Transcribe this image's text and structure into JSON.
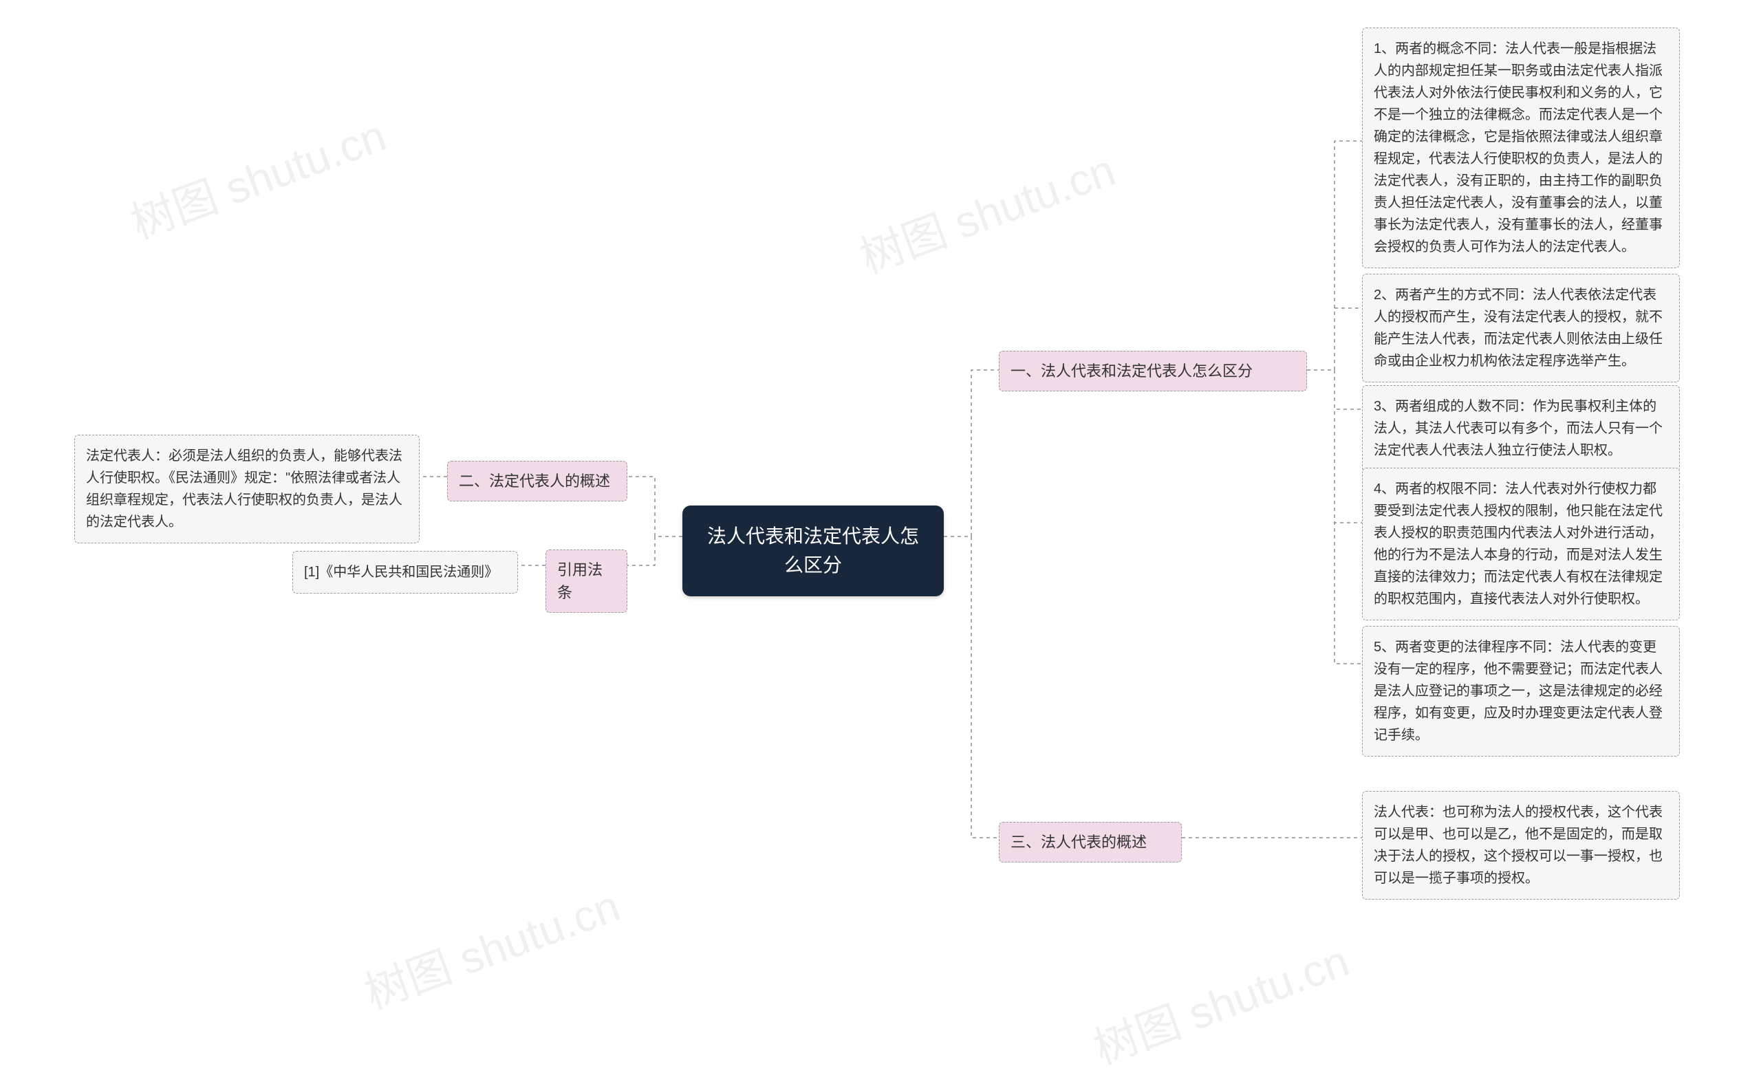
{
  "root": {
    "title": "法人代表和法定代表人怎么区分"
  },
  "sections": {
    "s1": {
      "title": "一、法人代表和法定代表人怎么区分",
      "items": [
        "1、两者的概念不同：法人代表一般是指根据法人的内部规定担任某一职务或由法定代表人指派代表法人对外依法行使民事权利和义务的人，它不是一个独立的法律概念。而法定代表人是一个确定的法律概念，它是指依照法律或法人组织章程规定，代表法人行使职权的负责人，是法人的法定代表人，没有正职的，由主持工作的副职负责人担任法定代表人，没有董事会的法人，以董事长为法定代表人，没有董事长的法人，经董事会授权的负责人可作为法人的法定代表人。",
        "2、两者产生的方式不同：法人代表依法定代表人的授权而产生，没有法定代表人的授权，就不能产生法人代表，而法定代表人则依法由上级任命或由企业权力机构依法定程序选举产生。",
        "3、两者组成的人数不同：作为民事权利主体的法人，其法人代表可以有多个，而法人只有一个法定代表人代表法人独立行使法人职权。",
        "4、两者的权限不同：法人代表对外行使权力都要受到法定代表人授权的限制，他只能在法定代表人授权的职责范围内代表法人对外进行活动，他的行为不是法人本身的行动，而是对法人发生直接的法律效力；而法定代表人有权在法律规定的职权范围内，直接代表法人对外行使职权。",
        "5、两者变更的法律程序不同：法人代表的变更没有一定的程序，他不需要登记；而法定代表人是法人应登记的事项之一，这是法律规定的必经程序，如有变更，应及时办理变更法定代表人登记手续。"
      ]
    },
    "s2": {
      "title": "二、法定代表人的概述",
      "leaf": "法定代表人：必须是法人组织的负责人，能够代表法人行使职权。《民法通则》规定：\"依照法律或者法人组织章程规定，代表法人行使职权的负责人，是法人的法定代表人。"
    },
    "s3": {
      "title": "三、法人代表的概述",
      "leaf": "法人代表：也可称为法人的授权代表，这个代表可以是甲、也可以是乙，他不是固定的，而是取决于法人的授权，这个授权可以一事一授权，也可以是一揽子事项的授权。"
    },
    "s4": {
      "title": "引用法条",
      "leaf": "[1]《中华人民共和国民法通则》"
    }
  },
  "watermarks": [
    "树图 shutu.cn",
    "树图 shutu.cn",
    "树图 shutu.cn",
    "树图 shutu.cn"
  ]
}
